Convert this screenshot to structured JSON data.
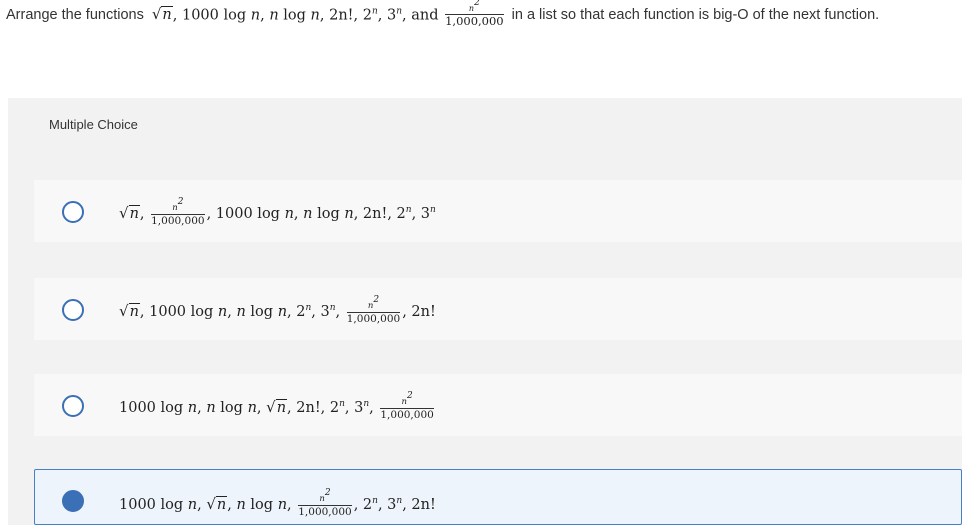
{
  "question": {
    "prefix": "Arrange the functions",
    "suffix": "in a list so that each function is big-O of the next function."
  },
  "math": {
    "n": "n",
    "sqrt": "√",
    "comma": ",",
    "and": "and",
    "log1000": "1000 log",
    "log": "log",
    "fact2n": "2n!",
    "pow_base2": "2",
    "pow_base3": "3",
    "frac_num": "n",
    "frac_num_exp": "2",
    "frac_den": "1,000,000"
  },
  "multiple_choice": {
    "label": "Multiple Choice",
    "selected_index": 3
  },
  "colors": {
    "accent": "#3b6fb6",
    "panel_bg": "#f2f2f2",
    "option_bg": "#f8f8f8",
    "selected_bg": "#eef4fb"
  }
}
